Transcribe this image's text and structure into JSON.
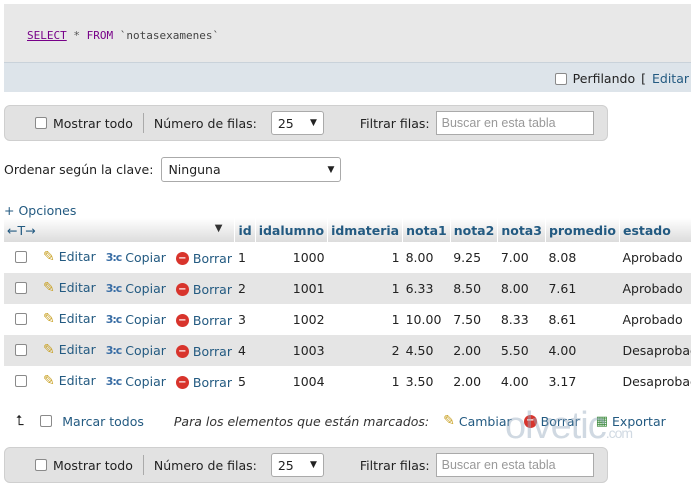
{
  "sql": {
    "kw_select": "SELECT",
    "star": "*",
    "kw_from": "FROM",
    "table": "`notasexamenes`"
  },
  "profile": {
    "label": "Perfilando",
    "bracket": "[",
    "edit_link": "Editar"
  },
  "nav": {
    "show_all": "Mostrar todo",
    "rows_label": "Número de filas:",
    "rows_value": "25",
    "filter_label": "Filtrar filas:",
    "filter_placeholder": "Buscar en esta tabla"
  },
  "sort": {
    "label": "Ordenar según la clave:",
    "value": "Ninguna"
  },
  "options_link": "+ Opciones",
  "columns": [
    "id",
    "idalumno",
    "idmateria",
    "nota1",
    "nota2",
    "nota3",
    "promedio",
    "estado"
  ],
  "actions": {
    "edit": "Editar",
    "copy": "Copiar",
    "delete": "Borrar"
  },
  "rows": [
    {
      "id": "1",
      "idalumno": "1000",
      "idmateria": "1",
      "nota1": "8.00",
      "nota2": "9.25",
      "nota3": "7.00",
      "promedio": "8.08",
      "estado": "Aprobado"
    },
    {
      "id": "2",
      "idalumno": "1001",
      "idmateria": "1",
      "nota1": "6.33",
      "nota2": "8.50",
      "nota3": "8.00",
      "promedio": "7.61",
      "estado": "Aprobado"
    },
    {
      "id": "3",
      "idalumno": "1002",
      "idmateria": "1",
      "nota1": "10.00",
      "nota2": "7.50",
      "nota3": "8.33",
      "promedio": "8.61",
      "estado": "Aprobado"
    },
    {
      "id": "4",
      "idalumno": "1003",
      "idmateria": "2",
      "nota1": "4.50",
      "nota2": "2.00",
      "nota3": "5.50",
      "promedio": "4.00",
      "estado": "Desaprobado"
    },
    {
      "id": "5",
      "idalumno": "1004",
      "idmateria": "1",
      "nota1": "3.50",
      "nota2": "2.00",
      "nota3": "4.00",
      "promedio": "3.17",
      "estado": "Desaprobado"
    }
  ],
  "bulk": {
    "select_all": "Marcar todos",
    "with_selected": "Para los elementos que están marcados:",
    "change": "Cambiar",
    "delete": "Borrar",
    "export": "Exportar"
  },
  "watermark": {
    "main": "olvetic",
    "suffix": ".com"
  },
  "colors": {
    "link": "#235a81",
    "row_alt": "#e5e5e5",
    "delete_icon": "#d8342c"
  }
}
